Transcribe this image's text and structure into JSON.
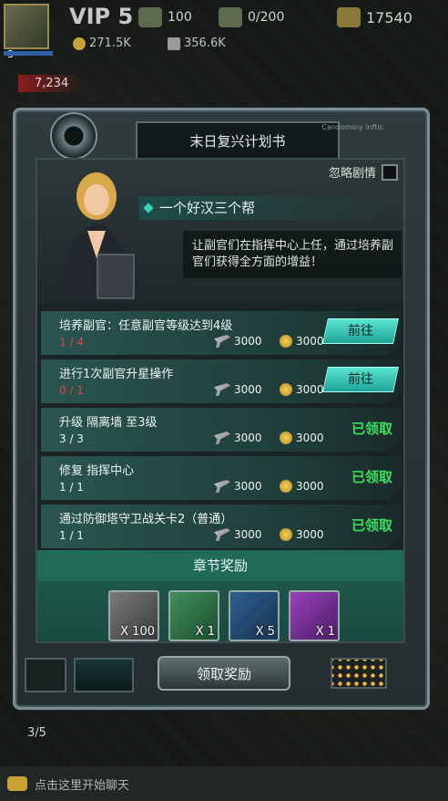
{
  "top": {
    "vip": "VIP 5",
    "player_level": "3",
    "stat_1": "100",
    "stat_2": "0/200",
    "stat_3": "17540",
    "res_1": "271.5K",
    "res_2": "356.6K",
    "power": "7,234"
  },
  "panel": {
    "title": "末日复兴计划书",
    "deco_text": "Candominy inftic"
  },
  "story": {
    "skip_label": "忽略剧情",
    "title": "一个好汉三个帮",
    "desc": "让副官们在指挥中心上任，通过培养副官们获得全方面的增益！"
  },
  "tasks": [
    {
      "name": "培养副官：任意副官等级达到4级",
      "progress": "1 / 4",
      "reward_gun": "3000",
      "reward_coin": "3000",
      "action": "前往",
      "status": "go",
      "progress_red": true
    },
    {
      "name": "进行1次副官升星操作",
      "progress": "0 / 1",
      "reward_gun": "3000",
      "reward_coin": "3000",
      "action": "前往",
      "status": "go",
      "progress_red": true
    },
    {
      "name": "升级 隔离墙 至3级",
      "progress": "3 / 3",
      "reward_gun": "3000",
      "reward_coin": "3000",
      "action": "已领取",
      "status": "claimed",
      "progress_red": false
    },
    {
      "name": "修复 指挥中心",
      "progress": "1 / 1",
      "reward_gun": "3000",
      "reward_coin": "3000",
      "action": "已领取",
      "status": "claimed",
      "progress_red": false
    },
    {
      "name": "通过防御塔守卫战关卡2（普通）",
      "progress": "1 / 1",
      "reward_gun": "3000",
      "reward_coin": "3000",
      "action": "已领取",
      "status": "claimed",
      "progress_red": false
    }
  ],
  "chapter": {
    "title": "章节奖励",
    "items": [
      {
        "icon": "tablet-item-icon",
        "count": "X 100"
      },
      {
        "icon": "officer-red-icon",
        "count": "X 1"
      },
      {
        "icon": "officer-blonde-icon",
        "count": "X 5"
      },
      {
        "icon": "gold-weapon-icon",
        "count": "X 1"
      }
    ]
  },
  "claim_button": "领取奖励",
  "counter": "3/5",
  "chat_placeholder": "点击这里开始聊天",
  "colors": {
    "accent": "#37e05e",
    "red": "#e04545",
    "teal": "#3bd6b6"
  }
}
